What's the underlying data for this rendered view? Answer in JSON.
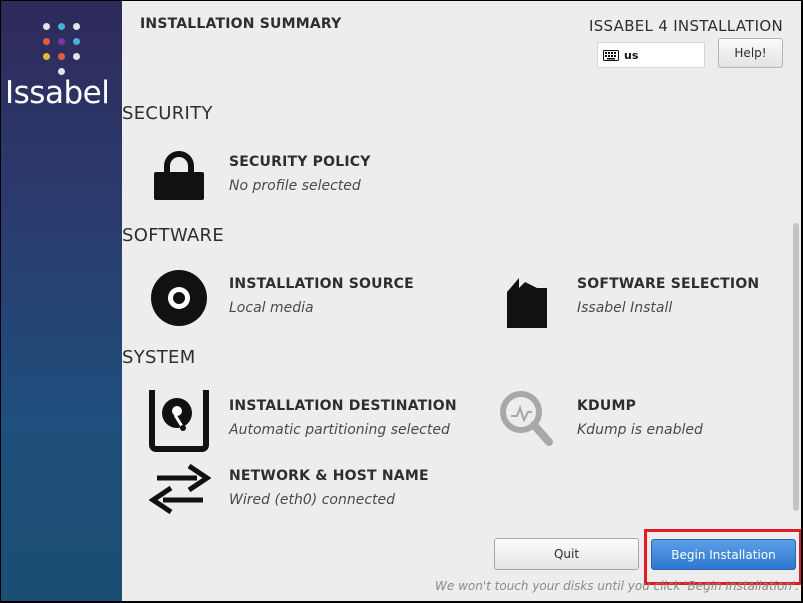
{
  "header": {
    "title": "INSTALLATION SUMMARY",
    "product": "ISSABEL 4 INSTALLATION",
    "keyboard_layout": "us",
    "help_label": "Help!"
  },
  "sidebar": {
    "logo_text": "Issabel",
    "dot_colors": [
      "#e1e5ea",
      "#46b3d6",
      "#e1e5ea",
      "#e85a3c",
      "#6a3fa0",
      "#46b3d6",
      "#e8b53c",
      "#e85a3c",
      "#e1e5ea",
      "#e1e5ea"
    ]
  },
  "sections": {
    "security": {
      "title": "SECURITY",
      "security_policy": {
        "title": "SECURITY POLICY",
        "status": "No profile selected",
        "icon": "lock-icon"
      }
    },
    "software": {
      "title": "SOFTWARE",
      "installation_source": {
        "title": "INSTALLATION SOURCE",
        "status": "Local media",
        "icon": "disc-icon"
      },
      "software_selection": {
        "title": "SOFTWARE SELECTION",
        "status": "Issabel Install",
        "icon": "package-icon"
      }
    },
    "system": {
      "title": "SYSTEM",
      "installation_destination": {
        "title": "INSTALLATION DESTINATION",
        "status": "Automatic partitioning selected",
        "icon": "hard-disk-icon"
      },
      "kdump": {
        "title": "KDUMP",
        "status": "Kdump is enabled",
        "icon": "magnifier-icon"
      },
      "network": {
        "title": "NETWORK & HOST NAME",
        "status": "Wired (eth0) connected",
        "icon": "network-arrows-icon"
      }
    }
  },
  "footer": {
    "quit_label": "Quit",
    "begin_label": "Begin Installation",
    "note": "We won't touch your disks until you click 'Begin Installation'."
  },
  "colors": {
    "accent": "#2f78cf",
    "highlight": "#e01b24",
    "background": "#ededed"
  }
}
